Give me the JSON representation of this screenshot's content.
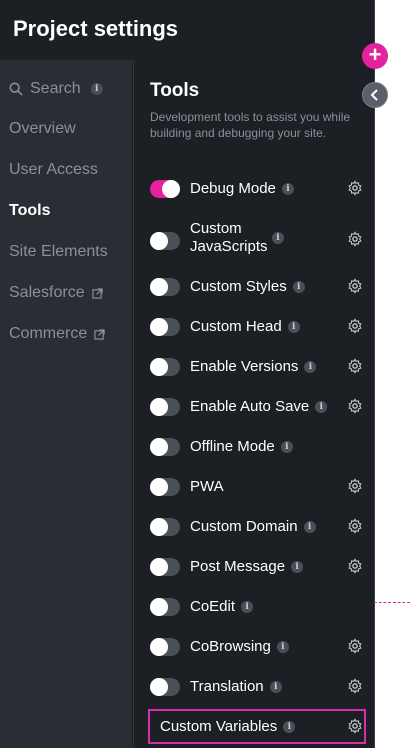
{
  "header": {
    "title": "Project settings"
  },
  "sidebar": {
    "items": [
      {
        "label": "Search",
        "info": "i"
      },
      {
        "label": "Overview"
      },
      {
        "label": "User Access"
      },
      {
        "label": "Tools",
        "active": true
      },
      {
        "label": "Site Elements"
      },
      {
        "label": "Salesforce",
        "external": true
      },
      {
        "label": "Commerce",
        "external": true
      }
    ]
  },
  "main": {
    "title": "Tools",
    "description": "Development tools to assist you while building and debugging your site.",
    "tools": [
      {
        "label": "Debug Mode",
        "enabled": true,
        "info": "i"
      },
      {
        "label": "Custom JavaScripts",
        "enabled": false,
        "info": "i"
      },
      {
        "label": "Custom Styles",
        "enabled": false,
        "info": "i"
      },
      {
        "label": "Custom Head",
        "enabled": false,
        "info": "i"
      },
      {
        "label": "Enable Versions",
        "enabled": false,
        "info": "i"
      },
      {
        "label": "Enable Auto Save",
        "enabled": false,
        "info": "i"
      },
      {
        "label": "Offline Mode",
        "enabled": false,
        "info": "i"
      },
      {
        "label": "PWA",
        "enabled": false
      },
      {
        "label": "Custom Domain",
        "enabled": false,
        "info": "i"
      },
      {
        "label": "Post Message",
        "enabled": false,
        "info": "i"
      },
      {
        "label": "CoEdit",
        "enabled": false,
        "info": "i"
      },
      {
        "label": "CoBrowsing",
        "enabled": false,
        "info": "i"
      },
      {
        "label": "Translation",
        "enabled": false,
        "info": "i"
      },
      {
        "label": "Custom Variables",
        "info": "i"
      }
    ]
  },
  "buttons": {
    "add": "+"
  },
  "colors": {
    "accent": "#e3239d",
    "highlight": "#d52fa9",
    "background": "#1c1f24"
  }
}
